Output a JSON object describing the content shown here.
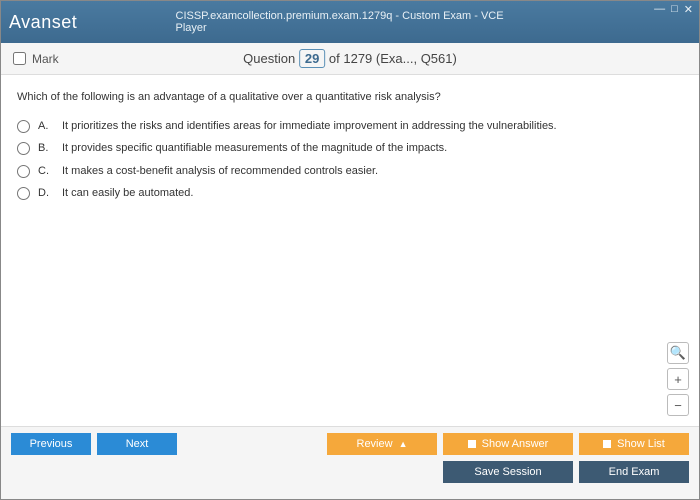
{
  "titlebar": {
    "logo_firstpart": "Avan",
    "logo_secondpart": "set",
    "title": "CISSP.examcollection.premium.exam.1279q - Custom Exam - VCE Player",
    "win_min": "—",
    "win_max": "□",
    "win_close": "✕"
  },
  "header": {
    "mark_label": "Mark",
    "question_label": "Question",
    "current_num": "29",
    "of_text": " of 1279 (Exa..., Q561)"
  },
  "question": {
    "text": "Which of the following is an advantage of a qualitative over a quantitative risk analysis?",
    "options": [
      {
        "letter": "A.",
        "text": "It prioritizes the risks and identifies areas for immediate improvement in addressing the vulnerabilities."
      },
      {
        "letter": "B.",
        "text": "It provides specific quantifiable measurements of the magnitude of the impacts."
      },
      {
        "letter": "C.",
        "text": "It makes a cost-benefit analysis of recommended controls easier."
      },
      {
        "letter": "D.",
        "text": "It can easily be automated."
      }
    ]
  },
  "zoom": {
    "mag": "🔍",
    "plus": "+",
    "minus": "−"
  },
  "footer": {
    "previous": "Previous",
    "next": "Next",
    "review": "Review",
    "show_answer": "Show Answer",
    "show_list": "Show List",
    "save_session": "Save Session",
    "end_exam": "End Exam"
  }
}
